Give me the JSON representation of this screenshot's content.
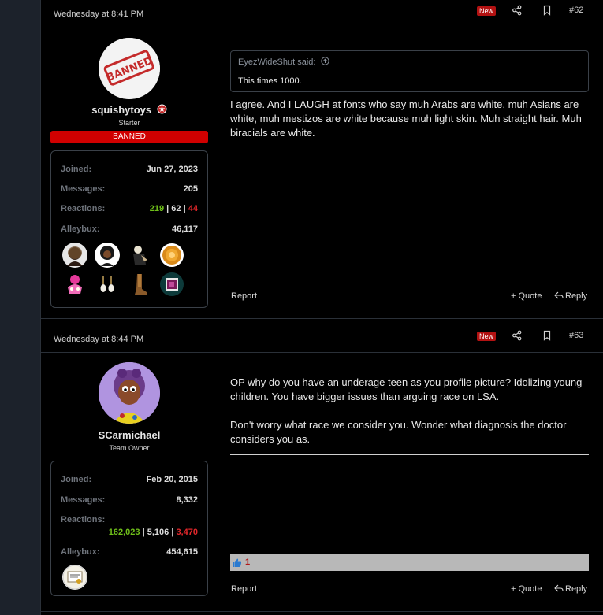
{
  "posts": [
    {
      "date": "Wednesday at 8:41 PM",
      "new_badge": "New",
      "post_number": "#62",
      "user": {
        "name": "squishytoys",
        "title": "Starter",
        "banned_label": "BANNED",
        "avatar_text": "BANNED",
        "stats": {
          "joined_label": "Joined:",
          "joined": "Jun 27, 2023",
          "messages_label": "Messages:",
          "messages": "205",
          "reactions_label": "Reactions:",
          "reactions_pos": "219",
          "reactions_sep1": " | ",
          "reactions_mid": "62",
          "reactions_sep2": " | ",
          "reactions_neg": "44",
          "alleybux_label": "Alleybux:",
          "alleybux": "46,117"
        }
      },
      "quote": {
        "author": "EyezWideShut said:",
        "text": "This times 1000."
      },
      "message": "I agree. And I LAUGH at fonts who say muh Arabs are white, muh Asians are white, muh mestizos are white because muh light skin. Muh straight hair. Muh biracials are white.",
      "footer": {
        "report": "Report",
        "quote": "+ Quote",
        "reply": "Reply"
      }
    },
    {
      "date": "Wednesday at 8:44 PM",
      "new_badge": "New",
      "post_number": "#63",
      "user": {
        "name": "SCarmichael",
        "title": "Team Owner",
        "stats": {
          "joined_label": "Joined:",
          "joined": "Feb 20, 2015",
          "messages_label": "Messages:",
          "messages": "8,332",
          "reactions_label": "Reactions:",
          "reactions_pos": "162,023",
          "reactions_sep1": " | ",
          "reactions_mid": "5,106",
          "reactions_sep2": " | ",
          "reactions_neg": "3,470",
          "alleybux_label": "Alleybux:",
          "alleybux": "454,615"
        }
      },
      "message_p1": "OP why do you have an underage teen as you profile picture? Idolizing young children. You have bigger issues than arguing race on LSA.",
      "message_p2": "Don't worry what race we consider you. Wonder what diagnosis the doctor considers you as.",
      "reaction_count": "1",
      "footer": {
        "report": "Report",
        "quote": "+ Quote",
        "reply": "Reply"
      }
    }
  ],
  "colors": {
    "accent_red": "#d00000",
    "new_badge": "#b31212",
    "positive": "#6fbf1a",
    "negative": "#e0262a"
  }
}
